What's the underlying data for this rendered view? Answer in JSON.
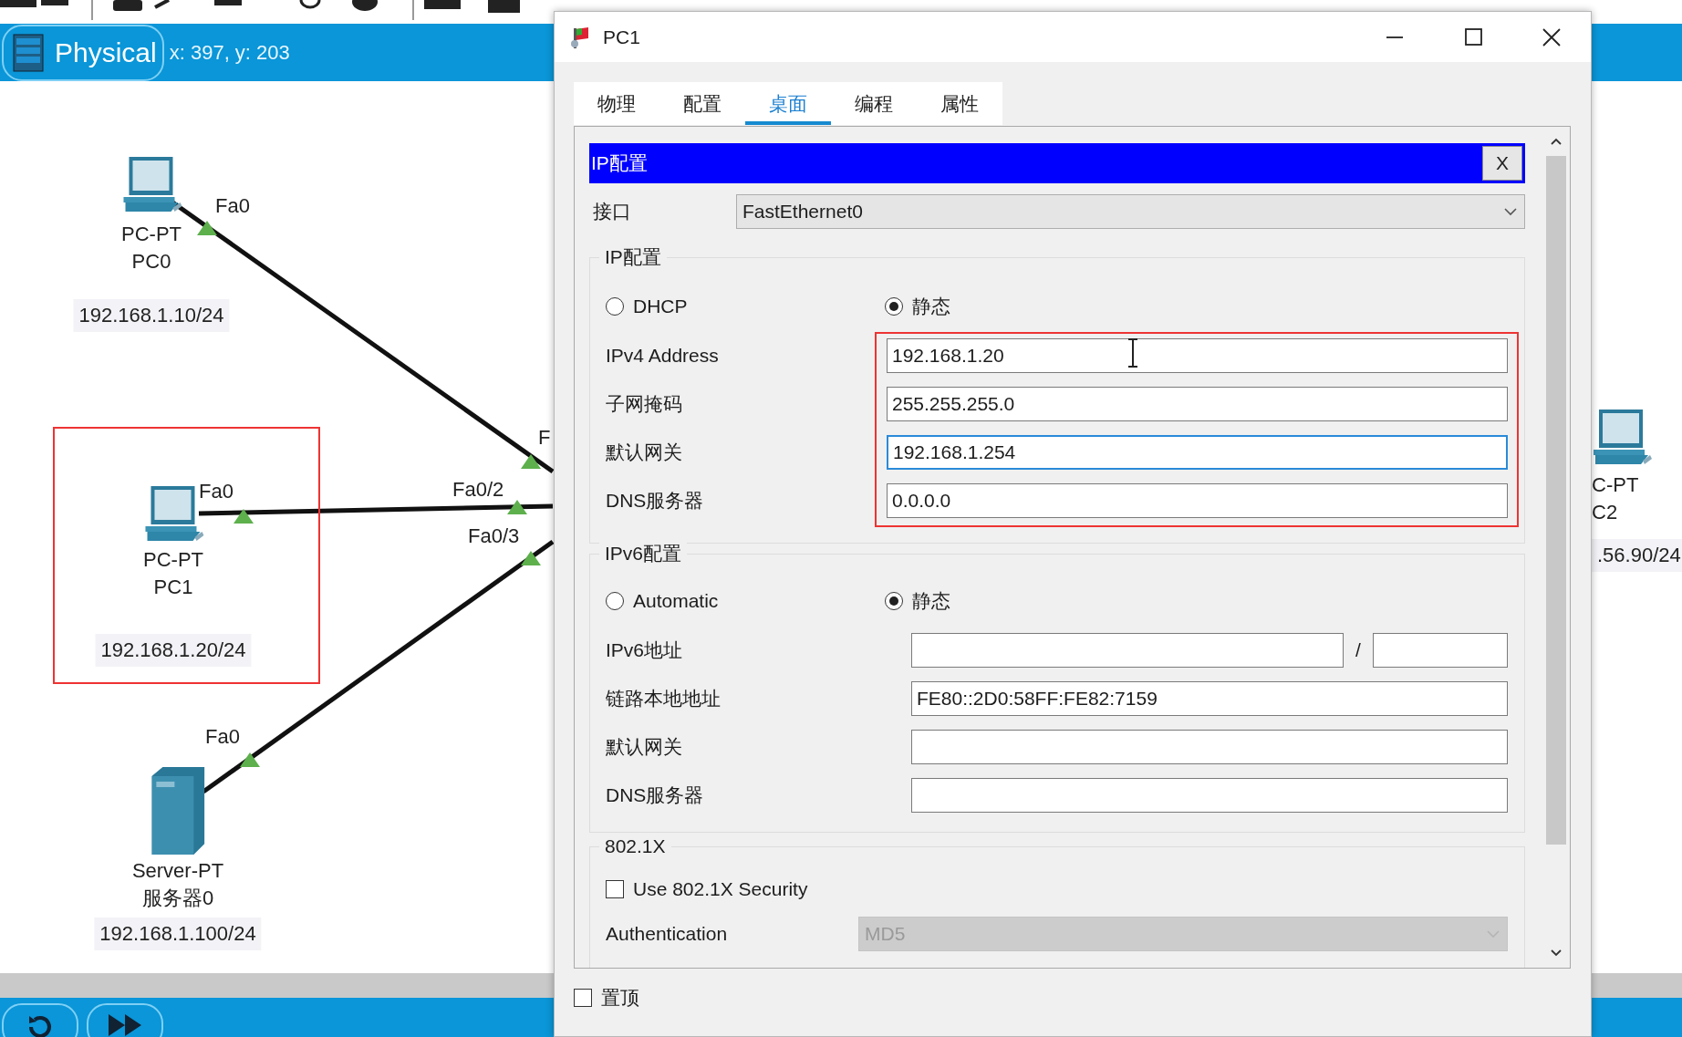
{
  "workspace": {
    "mode": "Physical",
    "cursor_position": "x: 397, y: 203"
  },
  "canvas": {
    "devices": [
      {
        "kind": "pc",
        "model": "PC-PT",
        "name": "PC0",
        "address": "192.168.1.10/24",
        "highlighted": false
      },
      {
        "kind": "pc",
        "model": "PC-PT",
        "name": "PC1",
        "address": "192.168.1.20/24",
        "highlighted": true
      },
      {
        "kind": "server",
        "model": "Server-PT",
        "name": "服务器0",
        "address": "192.168.1.100/24",
        "highlighted": false
      },
      {
        "kind": "pc",
        "model": "C-PT",
        "name": "C2",
        "address": ".56.90/24",
        "highlighted": false
      }
    ],
    "port_labels": [
      "Fa0",
      "F",
      "Fa0",
      "Fa0/2",
      "Fa0/3",
      "Fa0"
    ]
  },
  "dialog": {
    "title": "PC1",
    "tabs": [
      {
        "label": "物理",
        "selected": false
      },
      {
        "label": "配置",
        "selected": false
      },
      {
        "label": "桌面",
        "selected": true
      },
      {
        "label": "编程",
        "selected": false
      },
      {
        "label": "属性",
        "selected": false
      }
    ],
    "panel": {
      "title": "IP配置",
      "close_label": "X",
      "interface": {
        "label": "接口",
        "value": "FastEthernet0"
      },
      "ipv4": {
        "title": "IP配置",
        "highlighted": true,
        "modes": [
          {
            "label": "DHCP",
            "selected": false
          },
          {
            "label": "静态",
            "selected": true
          }
        ],
        "fields": [
          {
            "label": "IPv4 Address",
            "value": "192.168.1.20",
            "focused": false
          },
          {
            "label": "子网掩码",
            "value": "255.255.255.0",
            "focused": false
          },
          {
            "label": "默认网关",
            "value": "192.168.1.254",
            "focused": true
          },
          {
            "label": "DNS服务器",
            "value": "0.0.0.0",
            "focused": false
          }
        ]
      },
      "ipv6": {
        "title": "IPv6配置",
        "modes": [
          {
            "label": "Automatic",
            "selected": false
          },
          {
            "label": "静态",
            "selected": true
          }
        ],
        "fields": [
          {
            "label": "IPv6地址",
            "kind": "address_prefix",
            "separator": "/"
          },
          {
            "label": "链路本地地址",
            "kind": "text",
            "value": "FE80::2D0:58FF:FE82:7159"
          },
          {
            "label": "默认网关",
            "kind": "text"
          },
          {
            "label": "DNS服务器",
            "kind": "text"
          }
        ]
      },
      "dot1x": {
        "title": "802.1X",
        "use_security": {
          "label": "Use 802.1X Security",
          "checked": false
        },
        "authentication": {
          "label": "Authentication",
          "value": "MD5",
          "disabled": true
        }
      }
    },
    "always_on_top": {
      "label": "置顶",
      "checked": false
    }
  }
}
